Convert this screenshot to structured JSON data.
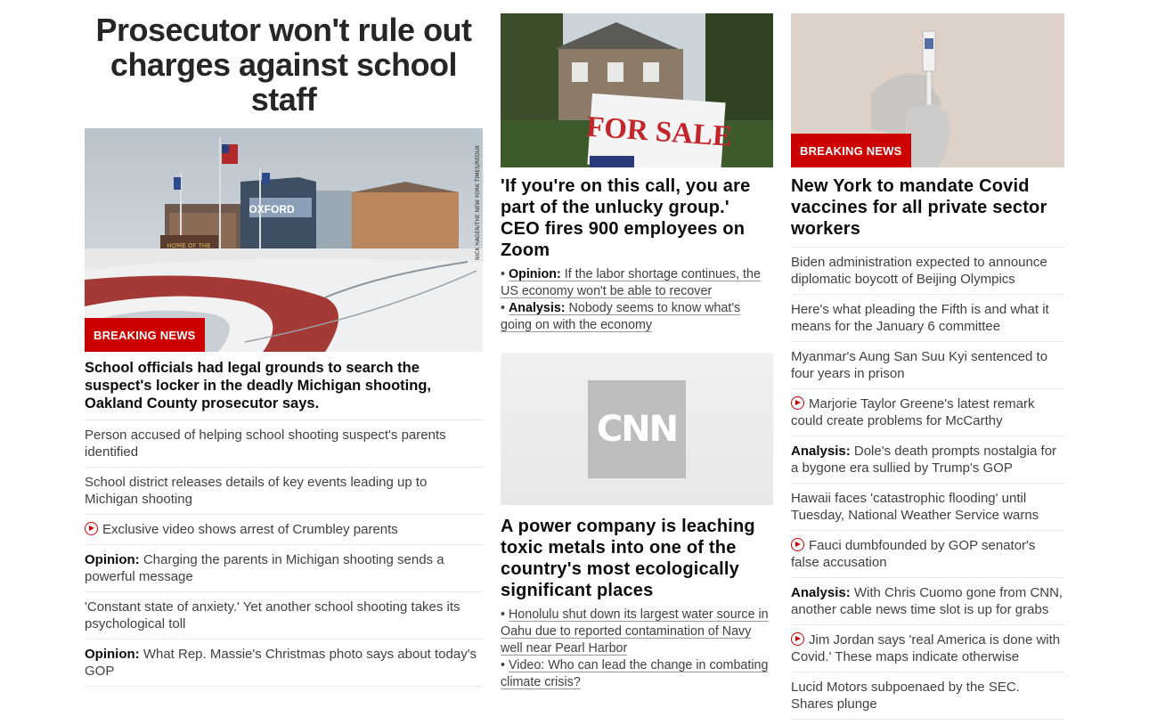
{
  "col1": {
    "headline": "Prosecutor won't rule out charges against school staff",
    "image_credit": "NICK HAGEN/THE NEW YORK TIMES/REDUX",
    "sign_text": "OXFORD",
    "badge": "BREAKING NEWS",
    "lead": "School officials had legal grounds to search the suspect's locker in the deadly Michigan shooting, Oakland County prosecutor says.",
    "links": [
      {
        "prefix": "",
        "video": false,
        "text": "Person accused of helping school shooting suspect's parents identified"
      },
      {
        "prefix": "",
        "video": false,
        "text": "School district releases details of key events leading up to Michigan shooting"
      },
      {
        "prefix": "",
        "video": true,
        "text": "Exclusive video shows arrest of Crumbley parents"
      },
      {
        "prefix": "Opinion:",
        "video": false,
        "text": "Charging the parents in Michigan shooting sends a powerful message"
      },
      {
        "prefix": "",
        "video": false,
        "text": "'Constant state of anxiety.' Yet another school shooting takes its psychological toll"
      },
      {
        "prefix": "Opinion:",
        "video": false,
        "text": "What Rep. Massie's Christmas photo says about today's GOP"
      }
    ]
  },
  "col2": {
    "story1": {
      "sign_text": "FOR SALE",
      "headline": "'If you're on this call, you are part of the unlucky group.' CEO fires 900 employees on Zoom",
      "sub": [
        {
          "prefix": "Opinion:",
          "text": "If the labor shortage continues, the US economy won't be able to recover"
        },
        {
          "prefix": "Analysis:",
          "text": "Nobody seems to know what's going on with the economy"
        }
      ]
    },
    "story2": {
      "logo": "CNN",
      "headline": "A power company is leaching toxic metals into one of the country's most ecologically significant places",
      "sub": [
        {
          "prefix": "",
          "text": "Honolulu shut down its largest water source in Oahu due to reported contamination of Navy well near Pearl Harbor"
        },
        {
          "prefix": "",
          "text": "Video: Who can lead the change in combating climate crisis?"
        }
      ]
    }
  },
  "col3": {
    "badge": "BREAKING NEWS",
    "headline": "New York to mandate Covid vaccines for all private sector workers",
    "links": [
      {
        "prefix": "",
        "video": false,
        "text": "Biden administration expected to announce diplomatic boycott of Beijing Olympics"
      },
      {
        "prefix": "",
        "video": false,
        "text": "Here's what pleading the Fifth is and what it means for the January 6 committee"
      },
      {
        "prefix": "",
        "video": false,
        "text": "Myanmar's Aung San Suu Kyi sentenced to four years in prison"
      },
      {
        "prefix": "",
        "video": true,
        "text": "Marjorie Taylor Greene's latest remark could create problems for McCarthy"
      },
      {
        "prefix": "Analysis:",
        "video": false,
        "text": "Dole's death prompts nostalgia for a bygone era sullied by Trump's GOP"
      },
      {
        "prefix": "",
        "video": false,
        "text": "Hawaii faces 'catastrophic flooding' until Tuesday, National Weather Service warns"
      },
      {
        "prefix": "",
        "video": true,
        "text": "Fauci dumbfounded by GOP senator's false accusation"
      },
      {
        "prefix": "Analysis:",
        "video": false,
        "text": "With Chris Cuomo gone from CNN, another cable news time slot is up for grabs"
      },
      {
        "prefix": "",
        "video": true,
        "text": "Jim Jordan says 'real America is done with Covid.' These maps indicate otherwise"
      },
      {
        "prefix": "",
        "video": false,
        "text": "Lucid Motors subpoenaed by the SEC. Shares plunge"
      }
    ]
  },
  "colors": {
    "breaking": "#cc0000",
    "divider": "#e6e6e6",
    "text": "#262626"
  }
}
